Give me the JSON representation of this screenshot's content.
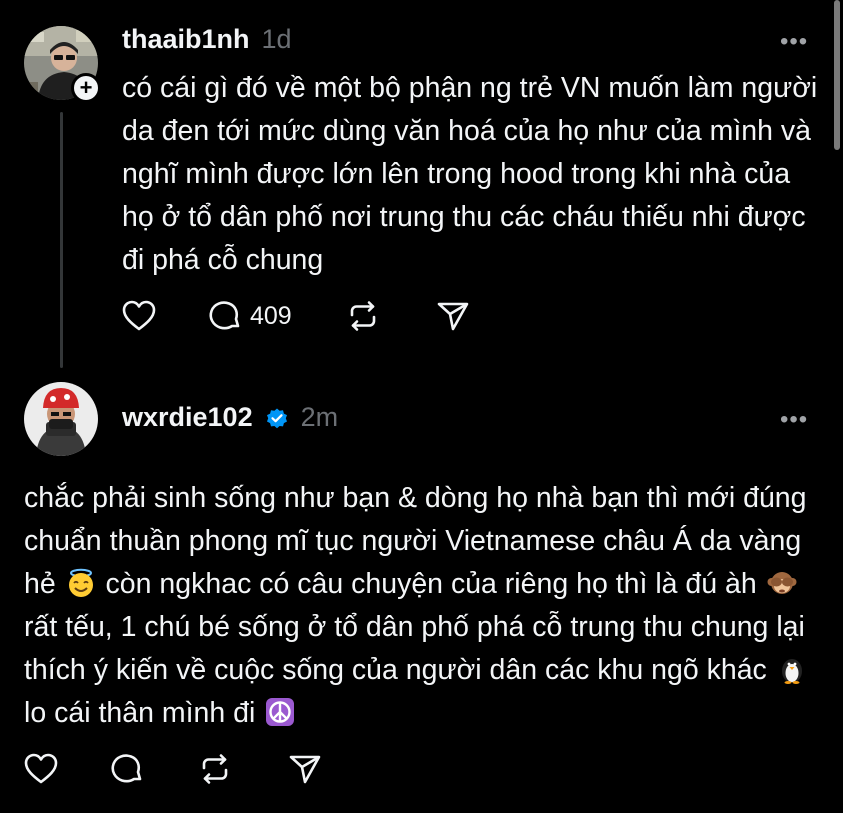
{
  "post": {
    "username": "thaaib1nh",
    "time": "1d",
    "more_label": "•••",
    "follow_badge": "+",
    "text": "có cái gì đó về một bộ phận ng trẻ VN muốn làm người da đen tới mức dùng văn hoá của họ như của mình và nghĩ mình được lớn lên trong hood trong khi nhà của họ ở tổ dân phố nơi trung thu các cháu thiếu nhi được đi phá cỗ chung",
    "actions": {
      "like_icon": "heart-icon",
      "reply_icon": "comment-icon",
      "reply_count": "409",
      "repost_icon": "repost-icon",
      "share_icon": "send-icon"
    }
  },
  "reply": {
    "username": "wxrdie102",
    "verified_icon": "verified-badge-icon",
    "time": "2m",
    "more_label": "•••",
    "text_parts": [
      "chắc phải sinh sống như bạn & dòng họ nhà bạn thì mới đúng chuẩn thuần phong mĩ tục người Vietnamese châu Á da vàng hẻ ",
      " còn ngkhac có câu chuyện của riêng họ thì là đú àh ",
      " rất tếu, 1 chú bé sống ở tổ dân phố phá cỗ trung thu chung lại thích ý kiến về cuộc sống của người dân các khu ngõ khác ",
      " lo cái thân mình đi "
    ],
    "emojis": [
      "smiling-face-with-halo",
      "see-no-evil-monkey",
      "penguin",
      "peace-symbol"
    ],
    "actions": {
      "like_icon": "heart-icon",
      "reply_icon": "comment-icon",
      "repost_icon": "repost-icon",
      "share_icon": "send-icon"
    }
  },
  "colors": {
    "background": "#000000",
    "text": "#f3f5f7",
    "muted": "#6c7075",
    "thread_line": "#333638",
    "verified": "#0095f6"
  }
}
